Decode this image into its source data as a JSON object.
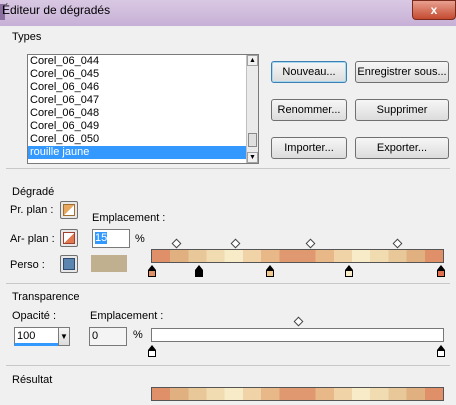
{
  "window": {
    "title": "Éditeur de dégradés",
    "close_label": "x"
  },
  "types": {
    "section_label": "Types",
    "list_items": [
      "Corel_06_044",
      "Corel_06_045",
      "Corel_06_046",
      "Corel_06_047",
      "Corel_06_048",
      "Corel_06_049",
      "Corel_06_050",
      "rouille jaune"
    ],
    "selected_index": 7,
    "buttons": {
      "new": "Nouveau...",
      "save_as": "Enregistrer sous...",
      "rename": "Renommer...",
      "delete": "Supprimer",
      "import": "Importer...",
      "export": "Exporter..."
    }
  },
  "gradient": {
    "section_label": "Dégradé",
    "fg_label": "Pr. plan :",
    "bg_label": "Ar- plan :",
    "custom_label": "Perso :",
    "location_label": "Emplacement :",
    "location_value": "15",
    "percent": "%",
    "fg_color": "#e8a860",
    "bg_color": "#e07850",
    "custom_color": "#5c86b0",
    "custom_swatch_color": "#c0b090",
    "bar_colors": [
      "#e09068",
      "#e0b080",
      "#e8c898",
      "#f0dcb0",
      "#f8ecc8",
      "#f0d4a8",
      "#e8b888",
      "#e09870"
    ],
    "stop_colors": [
      "#e09068",
      "#000000",
      "#f0c890",
      "#f8ecc8",
      "#f8ecc8",
      "#e07050"
    ]
  },
  "transparency": {
    "section_label": "Transparence",
    "opacity_label": "Opacité :",
    "opacity_value": "100",
    "location_label": "Emplacement :",
    "location_value": "0",
    "percent": "%"
  },
  "result": {
    "section_label": "Résultat"
  }
}
